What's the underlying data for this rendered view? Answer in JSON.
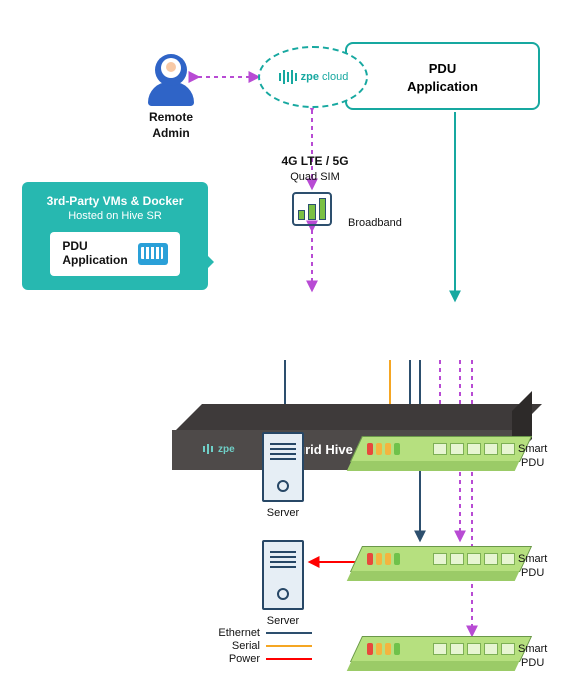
{
  "cloud": {
    "brand": "zpe",
    "suffix": "cloud",
    "app_label": "PDU\nApplication"
  },
  "remote_admin": {
    "label": "Remote\nAdmin"
  },
  "wireless": {
    "title": "4G LTE / 5G",
    "subtitle": "Quad SIM",
    "broadband": "Broadband"
  },
  "callout": {
    "title": "3rd-Party VMs & Docker",
    "subtitle": "Hosted on Hive SR",
    "app_label": "PDU\nApplication"
  },
  "hive": {
    "brand": "zpe",
    "name": "Nodegrid Hive SR"
  },
  "servers": {
    "label": "Server"
  },
  "pdus": {
    "label": "Smart\nPDU"
  },
  "legend": {
    "ethernet": "Ethernet",
    "serial": "Serial",
    "power": "Power"
  },
  "colors": {
    "ethernet": "#2d4f6e",
    "serial": "#f5a623",
    "power": "#ff0000",
    "cloud_dash": "#b84bd4",
    "teal": "#17a8a0"
  }
}
